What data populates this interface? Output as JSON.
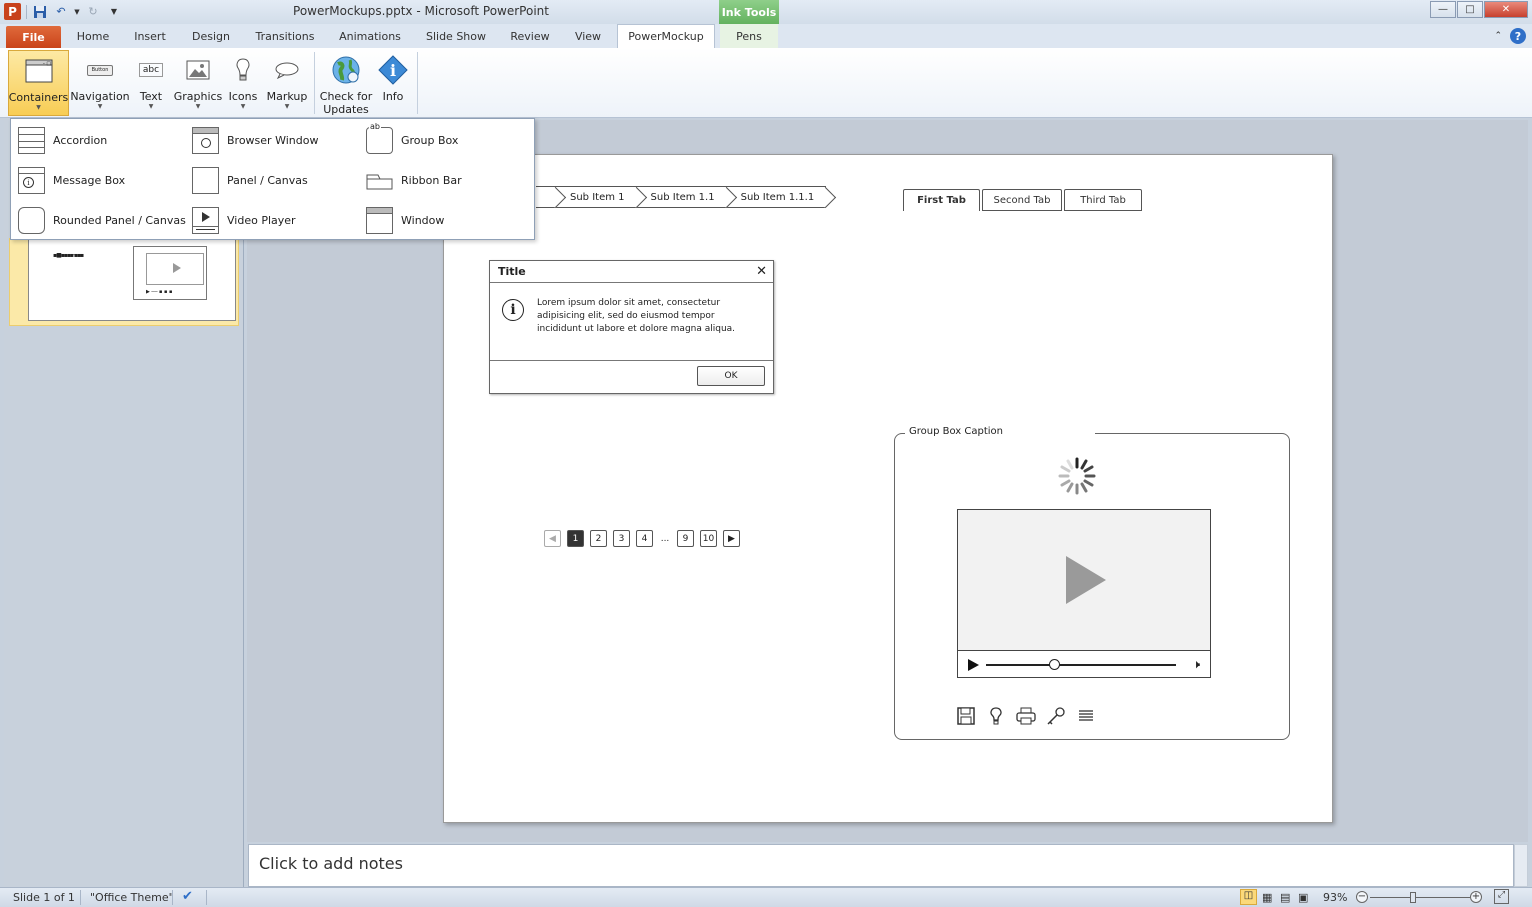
{
  "window": {
    "title": "PowerMockups.pptx - Microsoft PowerPoint",
    "contextual_tab_group": "Ink Tools"
  },
  "tabs": [
    {
      "label": "File"
    },
    {
      "label": "Home"
    },
    {
      "label": "Insert"
    },
    {
      "label": "Design"
    },
    {
      "label": "Transitions"
    },
    {
      "label": "Animations"
    },
    {
      "label": "Slide Show"
    },
    {
      "label": "Review"
    },
    {
      "label": "View"
    },
    {
      "label": "PowerMockup"
    },
    {
      "label": "Pens"
    }
  ],
  "ribbon": {
    "containers": "Containers",
    "navigation": "Navigation",
    "text": "Text",
    "graphics": "Graphics",
    "icons": "Icons",
    "markup": "Markup",
    "check_updates_1": "Check for",
    "check_updates_2": "Updates",
    "info": "Info",
    "button_icon_text": "Button",
    "text_icon_text": "abc"
  },
  "gallery": {
    "items": [
      {
        "label": "Accordion"
      },
      {
        "label": "Browser Window"
      },
      {
        "label": "Group Box"
      },
      {
        "label": "Message Box"
      },
      {
        "label": "Panel / Canvas"
      },
      {
        "label": "Ribbon Bar"
      },
      {
        "label": "Rounded Panel / Canvas"
      },
      {
        "label": "Video Player"
      },
      {
        "label": "Window"
      }
    ],
    "groupbox_icon_text": "ab"
  },
  "slide": {
    "breadcrumb": [
      "Sub Item 1",
      "Sub Item 1.1",
      "Sub Item 1.1.1"
    ],
    "tabs": [
      "First Tab",
      "Second Tab",
      "Third Tab"
    ],
    "message_box": {
      "title": "Title",
      "body": "Lorem ipsum dolor sit amet, consectetur adipisicing elit, sed do eiusmod tempor incididunt ut labore et dolore magna aliqua.",
      "ok": "OK"
    },
    "pagination": {
      "pages": [
        "1",
        "2",
        "3",
        "4",
        "9",
        "10"
      ],
      "ellipsis": "...",
      "active": "1"
    },
    "group_box": {
      "caption": "Group Box Caption"
    }
  },
  "notes": {
    "placeholder": "Click to add notes"
  },
  "status": {
    "slide": "Slide 1 of 1",
    "theme": "\"Office Theme\"",
    "zoom": "93%"
  },
  "colors": {
    "file_tab": "#c9431a",
    "ink_tools": "#63b25e",
    "selected_button": "#f8cd55"
  }
}
